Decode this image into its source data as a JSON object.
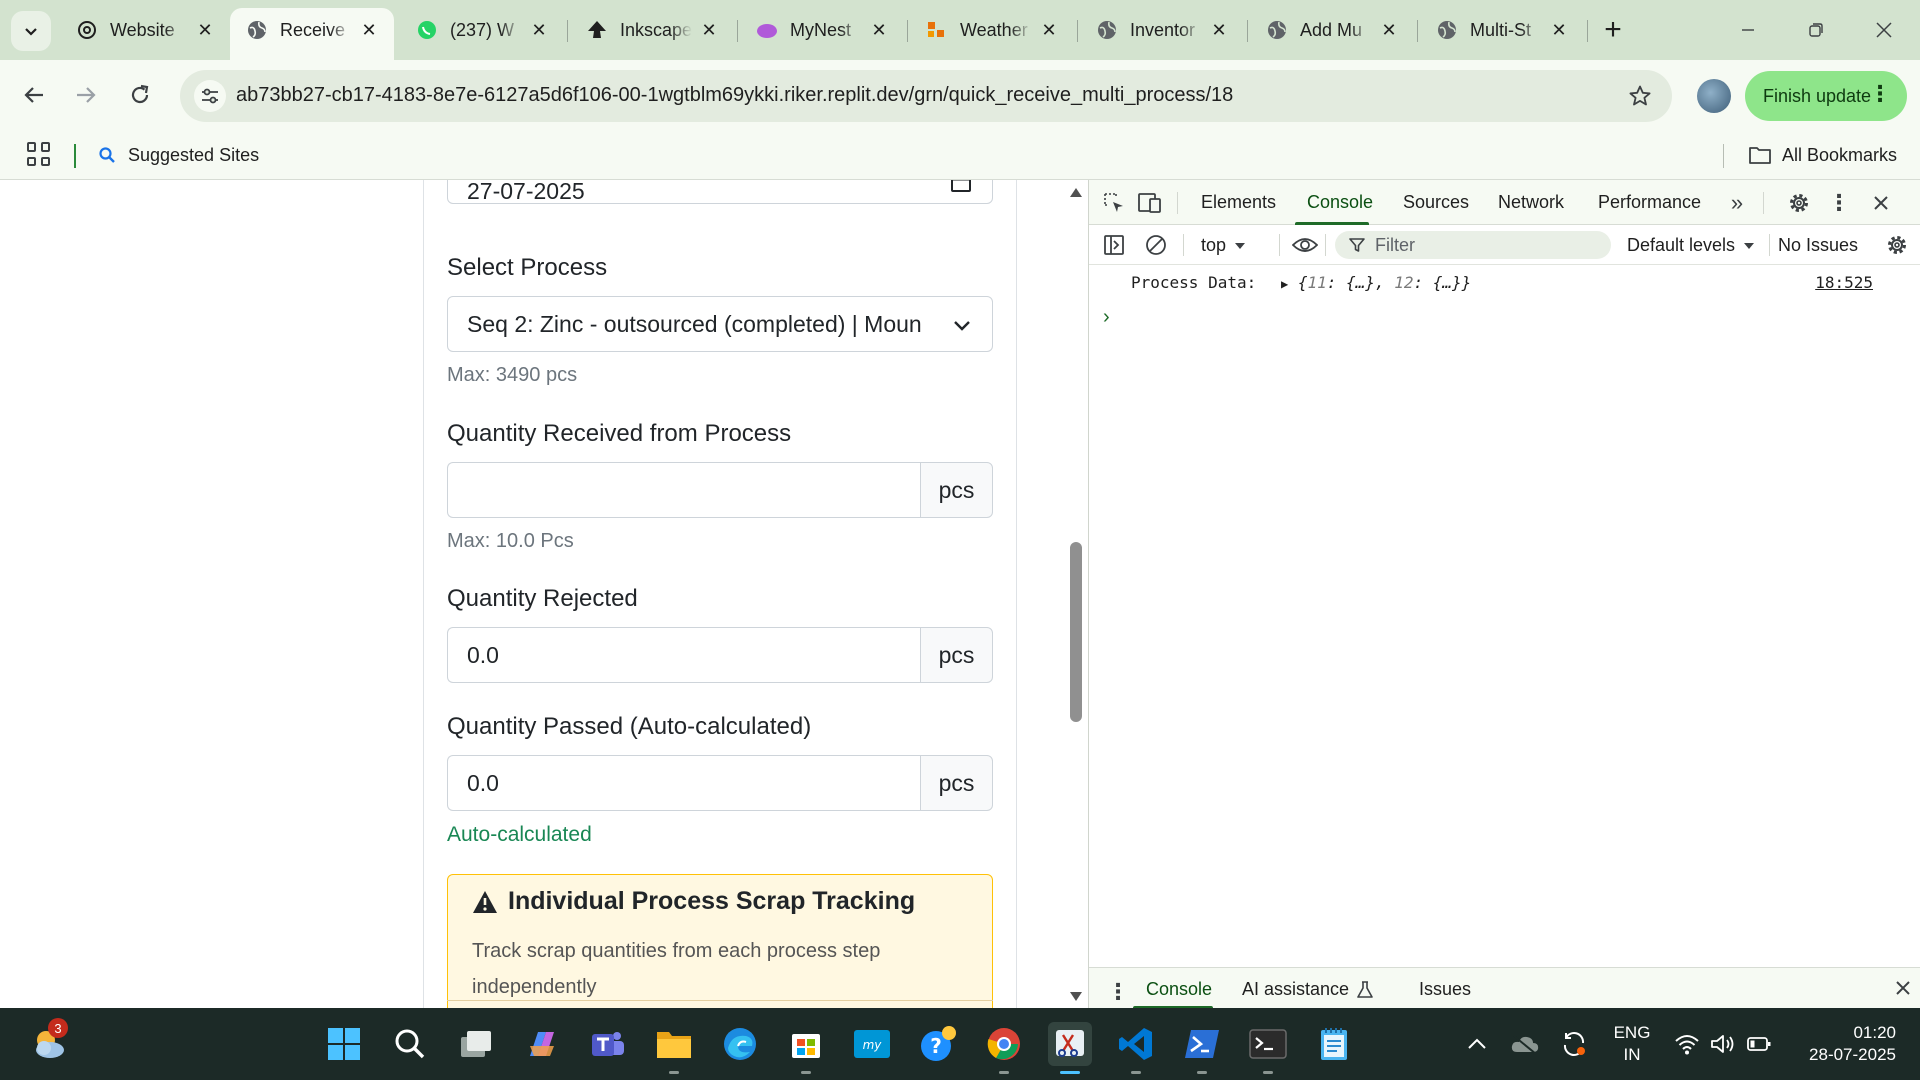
{
  "browser": {
    "tabs": [
      {
        "title": "Website",
        "icon": "openai-icon",
        "active": false
      },
      {
        "title": "Receive",
        "icon": "globe-icon",
        "active": true
      },
      {
        "title": "(237) W",
        "icon": "whatsapp-icon",
        "active": false
      },
      {
        "title": "Inkscape",
        "icon": "inkscape-icon",
        "active": false
      },
      {
        "title": "MyNest",
        "icon": "mynest-icon",
        "active": false
      },
      {
        "title": "Weather",
        "icon": "weather-icon",
        "active": false
      },
      {
        "title": "Inventor",
        "icon": "globe-icon",
        "active": false
      },
      {
        "title": "Add Mu",
        "icon": "globe-icon",
        "active": false
      },
      {
        "title": "Multi-St",
        "icon": "globe-icon",
        "active": false
      }
    ],
    "url": "ab73bb27-cb17-4183-8e7e-6127a5d6f106-00-1wgtblm69ykki.riker.replit.dev/grn/quick_receive_multi_process/18",
    "finish_update_label": "Finish update",
    "bookmarks": {
      "suggested": "Suggested Sites",
      "all": "All Bookmarks"
    }
  },
  "form": {
    "date_value": "27-07-2025",
    "select_process_label": "Select Process",
    "select_process_value": "Seq 2: Zinc - outsourced (completed) | Moun",
    "select_process_help": "Max: 3490 pcs",
    "qty_received_label": "Quantity Received from Process",
    "qty_received_value": "",
    "qty_received_unit": "pcs",
    "qty_received_help": "Max: 10.0 Pcs",
    "qty_rejected_label": "Quantity Rejected",
    "qty_rejected_value": "0.0",
    "qty_rejected_unit": "pcs",
    "qty_passed_label": "Quantity Passed (Auto-calculated)",
    "qty_passed_value": "0.0",
    "qty_passed_unit": "pcs",
    "qty_passed_help": "Auto-calculated",
    "scrap_card_title": "Individual Process Scrap Tracking",
    "scrap_card_text": "Track scrap quantities from each process step independently"
  },
  "devtools": {
    "tabs": [
      "Elements",
      "Console",
      "Sources",
      "Network",
      "Performance"
    ],
    "active_tab": "Console",
    "context": "top",
    "filter_placeholder": "Filter",
    "levels": "Default levels",
    "issues": "No Issues",
    "console_message": "Process Data:",
    "console_object": {
      "k1": "11",
      "v1": "{…}",
      "k2": "12",
      "v2": "{…}"
    },
    "console_source": "18:525",
    "drawer_tabs": [
      "Console",
      "AI assistance",
      "Issues"
    ]
  },
  "taskbar": {
    "weather_badge": "3",
    "language_top": "ENG",
    "language_bottom": "IN",
    "time": "01:20",
    "date": "28-07-2025"
  },
  "colors": {
    "tabstrip_bg": "#d3e3cf",
    "toolbar_bg": "#f6faf3",
    "finish_update_bg": "#8ee58a",
    "success_text": "#198754",
    "warning_border": "#ffc107",
    "taskbar_bg": "#1c2a27"
  }
}
